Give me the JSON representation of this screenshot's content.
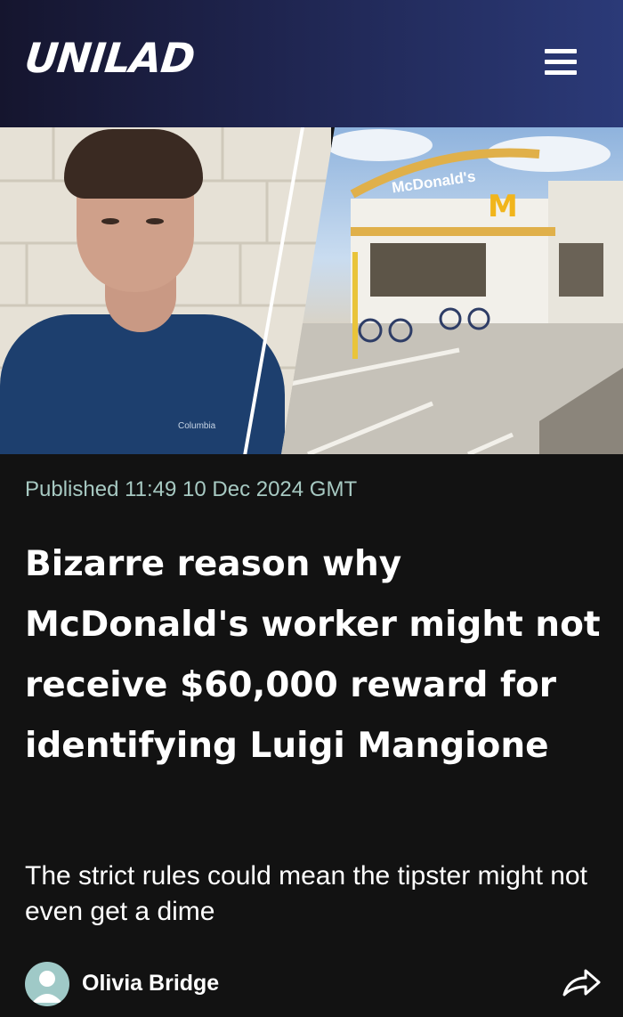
{
  "header": {
    "logo_text": "UNILAD",
    "menu_icon": "hamburger-menu-icon"
  },
  "hero": {
    "sign_text": "McDonald's",
    "shirt_text": "Columbia"
  },
  "article": {
    "published": "Published 11:49 10 Dec 2024 GMT",
    "title": "Bizarre reason why McDonald's worker might not receive $60,000 reward for identifying Luigi Mangione",
    "subtitle": "The strict rules could mean the tipster might not even get a dime"
  },
  "author": {
    "name": "Olivia Bridge",
    "avatar_icon": "person-avatar-icon"
  },
  "share_icon": "share-arrow-icon",
  "colors": {
    "background": "#121212",
    "header_start": "#15152e",
    "header_end": "#2b3a78",
    "published_text": "#a7c9c2",
    "avatar_bg": "#9fc9c7"
  }
}
